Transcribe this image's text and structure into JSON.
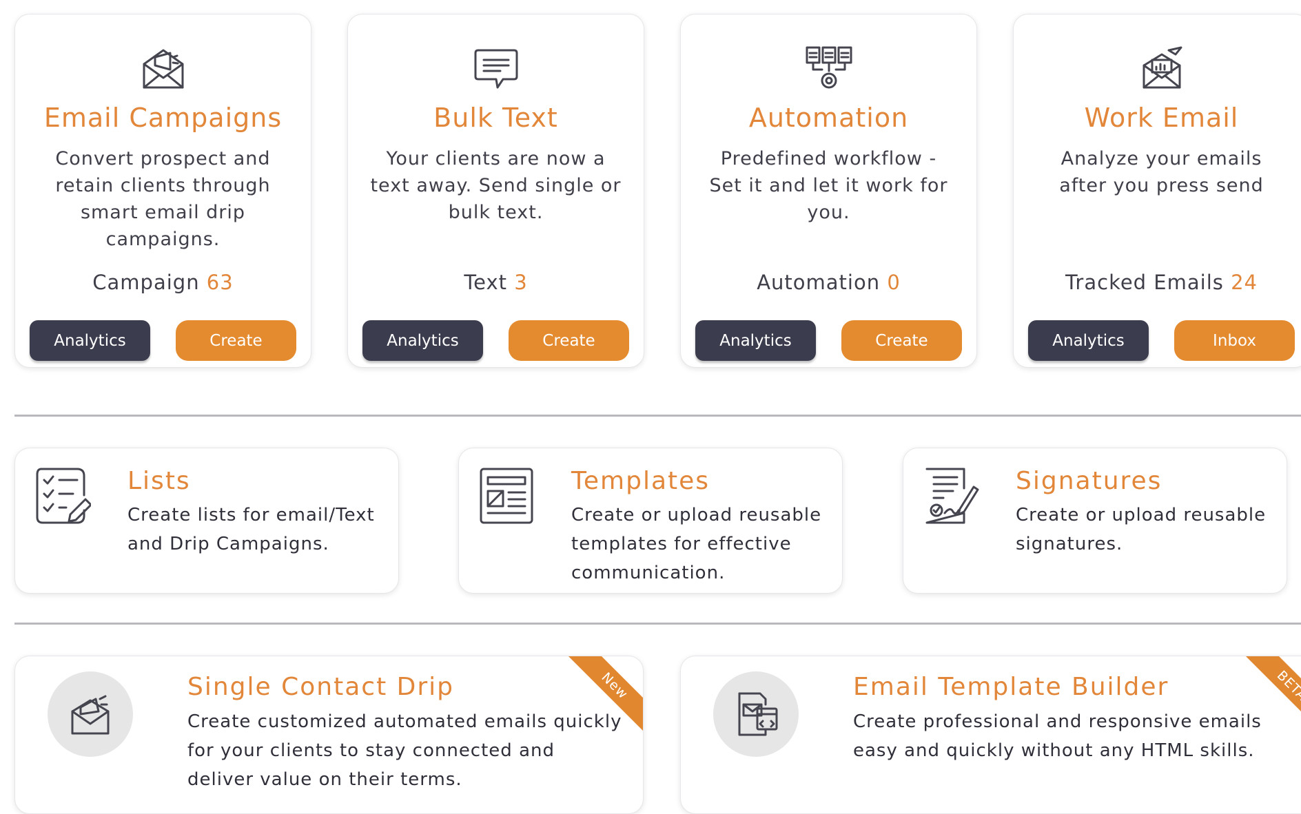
{
  "top_cards": [
    {
      "icon": "email-campaign-icon",
      "title": "Email Campaigns",
      "description": "Convert prospect and retain clients through smart email drip campaigns.",
      "stat_label": "Campaign",
      "stat_value": "63",
      "secondary_label": "Analytics",
      "primary_label": "Create"
    },
    {
      "icon": "chat-bubble-icon",
      "title": "Bulk Text",
      "description": "Your clients are now a text away. Send single or bulk text.",
      "stat_label": "Text",
      "stat_value": "3",
      "secondary_label": "Analytics",
      "primary_label": "Create"
    },
    {
      "icon": "workflow-gear-icon",
      "title": "Automation",
      "description": "Predefined workflow - Set it and let it work for you.",
      "stat_label": "Automation",
      "stat_value": "0",
      "secondary_label": "Analytics",
      "primary_label": "Create"
    },
    {
      "icon": "tracked-email-icon",
      "title": "Work Email",
      "description": "Analyze your emails after you press send",
      "stat_label": "Tracked Emails",
      "stat_value": "24",
      "secondary_label": "Analytics",
      "primary_label": "Inbox"
    }
  ],
  "mid_cards": [
    {
      "icon": "checklist-icon",
      "title": "Lists",
      "description": "Create lists for email/Text and Drip Campaigns."
    },
    {
      "icon": "template-icon",
      "title": "Templates",
      "description": "Create or upload reusable templates for effective communication."
    },
    {
      "icon": "signature-icon",
      "title": "Signatures",
      "description": "Create or upload reusable signatures."
    }
  ],
  "bottom_cards": [
    {
      "icon": "megaphone-envelope-icon",
      "title": "Single Contact Drip",
      "description": "Create customized automated emails quickly for your clients to stay connected and deliver value on their terms.",
      "badge": "New"
    },
    {
      "icon": "email-builder-icon",
      "title": "Email Template Builder",
      "description": "Create professional and responsive emails easy and quickly without any HTML skills.",
      "badge": "BETA"
    }
  ],
  "colors": {
    "accent": "#e2873a",
    "dark_button": "#3b3c4e",
    "text": "#3f3f4a",
    "divider": "#b8b8bd"
  }
}
